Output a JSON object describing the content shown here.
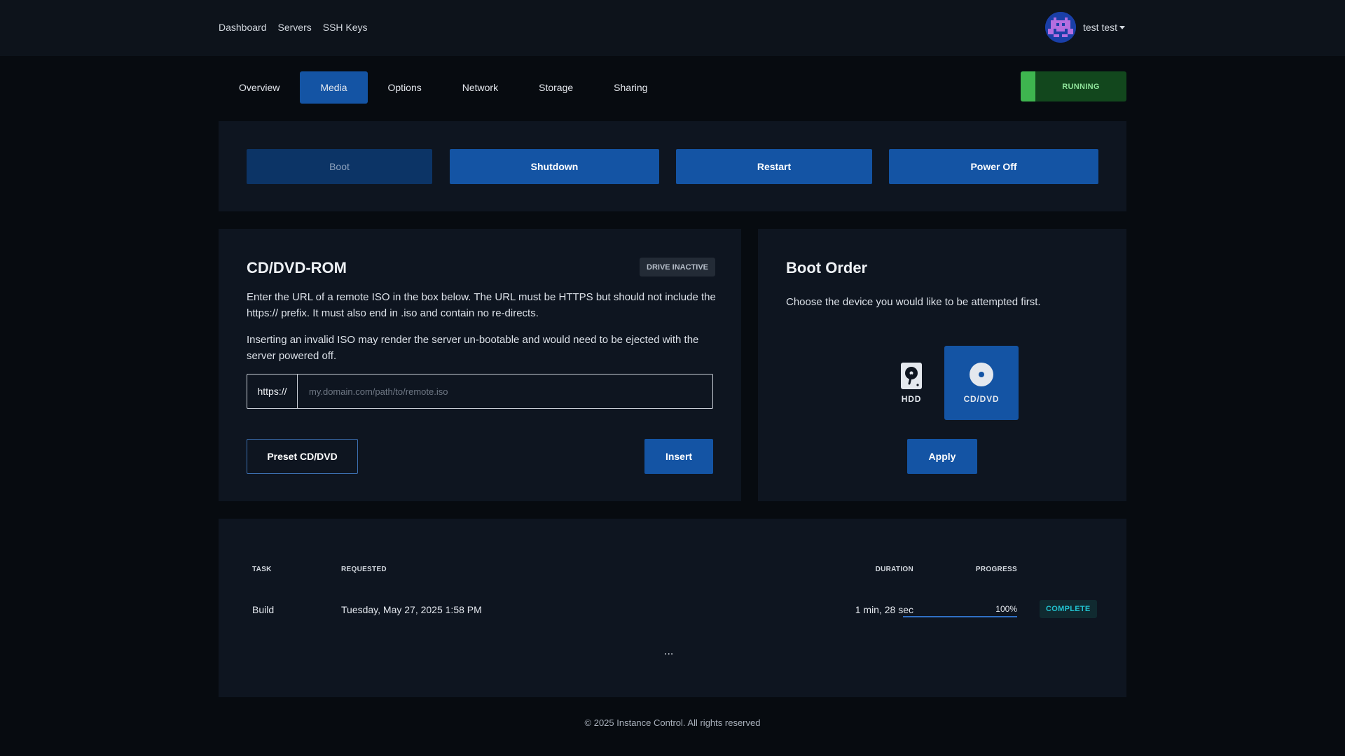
{
  "nav": {
    "items": [
      "Dashboard",
      "Servers",
      "SSH Keys"
    ],
    "user": "test test"
  },
  "tabs": [
    "Overview",
    "Media",
    "Options",
    "Network",
    "Storage",
    "Sharing"
  ],
  "active_tab": "Media",
  "status": "RUNNING",
  "power": {
    "boot": "Boot",
    "shutdown": "Shutdown",
    "restart": "Restart",
    "poweroff": "Power Off"
  },
  "cd": {
    "title": "CD/DVD-ROM",
    "badge": "DRIVE INACTIVE",
    "p1": "Enter the URL of a remote ISO in the box below. The URL must be HTTPS but should not include the https:// prefix. It must also end in .iso and contain no re-directs.",
    "p2": "Inserting an invalid ISO may render the server un-bootable and would need to be ejected with the server powered off.",
    "prefix": "https://",
    "placeholder": "my.domain.com/path/to/remote.iso",
    "value": "",
    "preset": "Preset CD/DVD",
    "insert": "Insert"
  },
  "boot": {
    "title": "Boot Order",
    "desc": "Choose the device you would like to be attempted first.",
    "hdd": "HDD",
    "cddvd": "CD/DVD",
    "selected": "CD/DVD",
    "apply": "Apply"
  },
  "tasks": {
    "headers": {
      "task": "TASK",
      "requested": "REQUESTED",
      "duration": "DURATION",
      "progress": "PROGRESS"
    },
    "rows": [
      {
        "task": "Build",
        "requested": "Tuesday, May 27, 2025 1:58 PM",
        "duration": "1 min, 28 sec",
        "progress": "100%",
        "progress_value": 100,
        "status": "COMPLETE"
      }
    ],
    "more": "..."
  },
  "footer": "© 2025 Instance Control. All rights reserved",
  "colors": {
    "accent": "#1454a4",
    "running": "#3eb54f",
    "complete": "#22c2cf"
  }
}
